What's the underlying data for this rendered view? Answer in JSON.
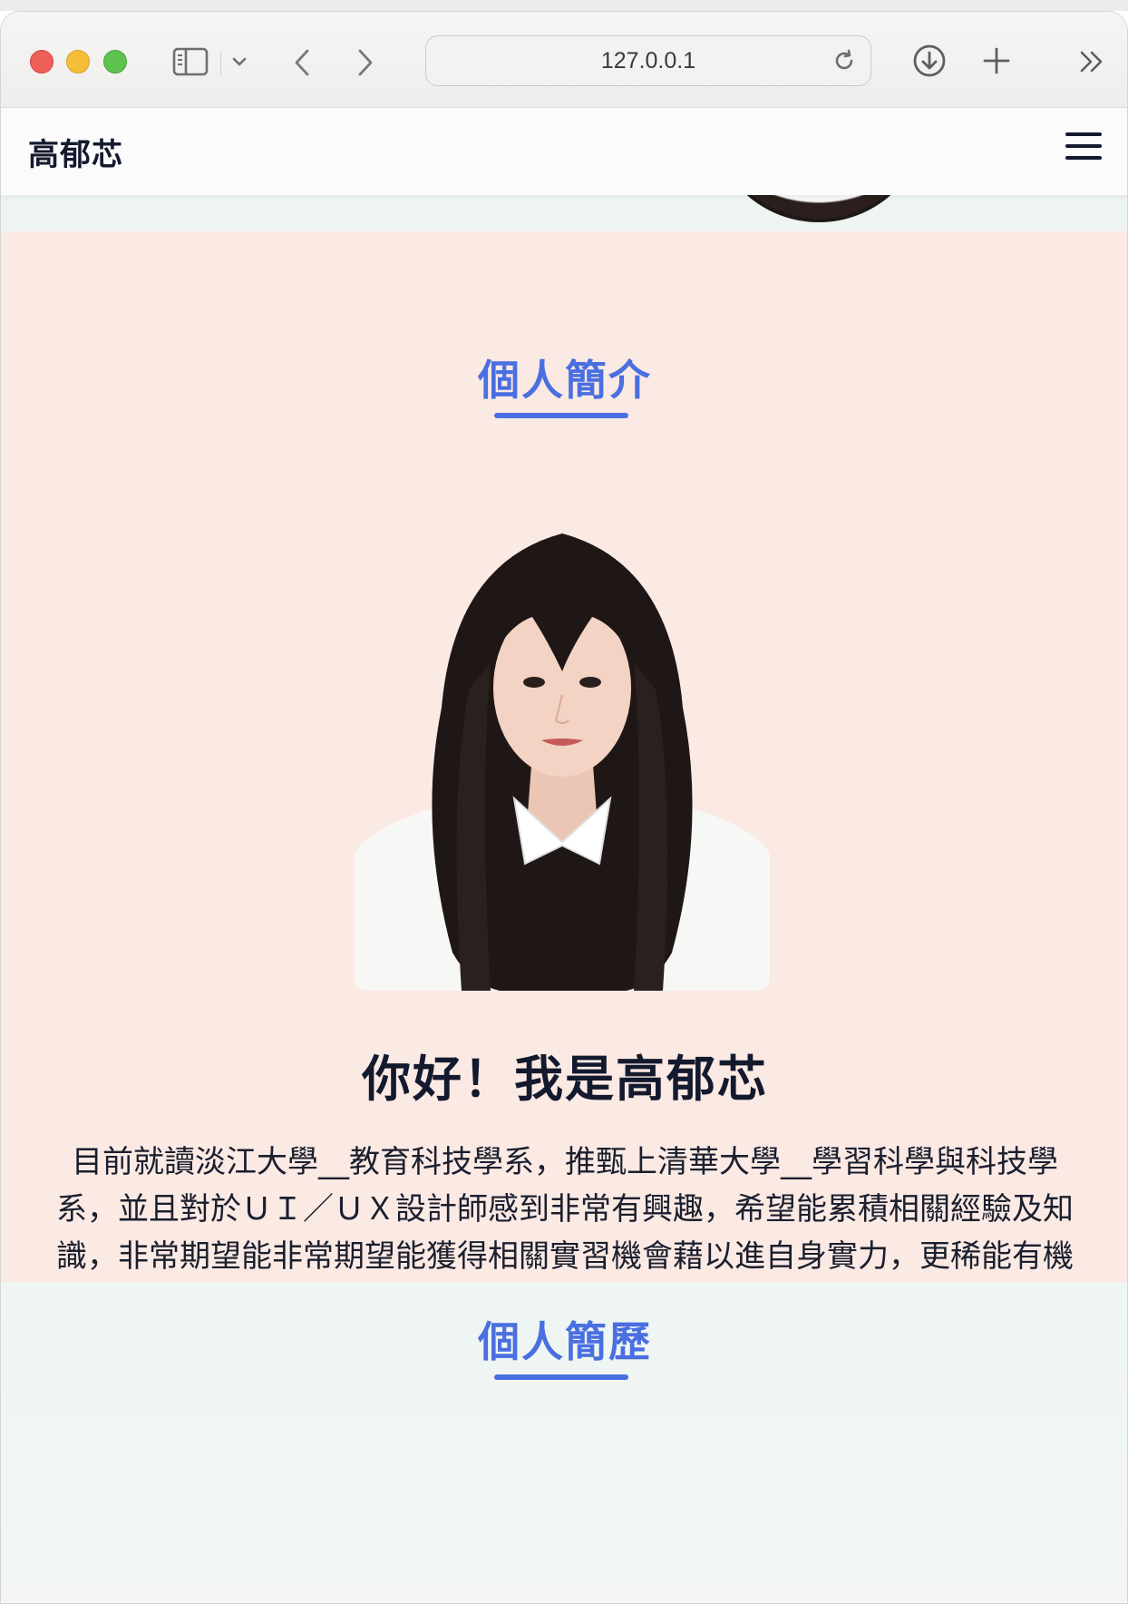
{
  "browser": {
    "url": "127.0.0.1",
    "icons": {
      "sidebar": "sidebar-icon",
      "chevron": "chevron-down-icon",
      "back": "chevron-left-icon",
      "forward": "chevron-right-icon",
      "reload": "reload-icon",
      "download": "download-icon",
      "newtab": "plus-icon",
      "overflow": "double-chevron-right-icon"
    }
  },
  "site": {
    "brand": "高郁芯",
    "menu_icon": "hamburger-menu-icon"
  },
  "about": {
    "title": "個人簡介",
    "greeting": "你好！我是高郁芯",
    "bio": "目前就讀淡江大學__教育科技學系，推甄上清華大學__學習科學與科技學系，並且對於ＵＩ／ＵＸ設計師感到非常有興趣，希望能累積相關經驗及知識，非常期望能非常期望能獲得相關實習機會藉以進自身實力，更稀能有機會進入貴公司就職！"
  },
  "resume": {
    "title": "個人簡歷"
  },
  "colors": {
    "accent": "#4a6fe0",
    "about_bg": "#fbe9e4",
    "resume_bg": "#eef5f2",
    "text_dark": "#141a2e"
  }
}
